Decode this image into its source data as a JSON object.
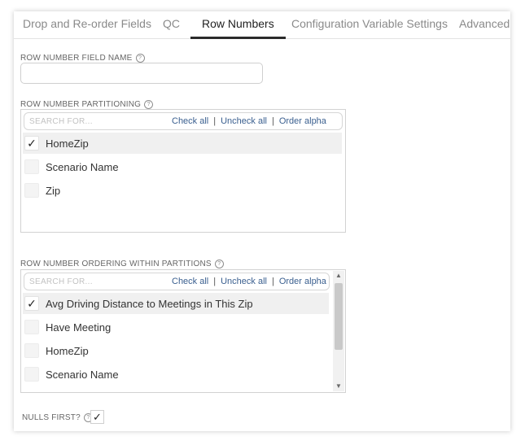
{
  "tabs": [
    {
      "label": "Drop and Re-order Fields",
      "active": false
    },
    {
      "label": "QC",
      "active": false
    },
    {
      "label": "Row Numbers",
      "active": true
    },
    {
      "label": "Configuration Variable Settings",
      "active": false
    },
    {
      "label": "Advanced",
      "active": false
    }
  ],
  "row_number_field": {
    "label": "ROW NUMBER FIELD NAME",
    "help": "?",
    "value": "",
    "placeholder": ""
  },
  "partitioning": {
    "label": "ROW NUMBER PARTITIONING",
    "help": "?",
    "search_placeholder": "SEARCH FOR...",
    "check_all": "Check all",
    "uncheck_all": "Uncheck all",
    "order_alpha": "Order alpha",
    "separator": "|",
    "items": [
      {
        "label": "HomeZip",
        "checked": true,
        "check": "✓"
      },
      {
        "label": "Scenario Name",
        "checked": false,
        "check": ""
      },
      {
        "label": "Zip",
        "checked": false,
        "check": ""
      }
    ]
  },
  "ordering": {
    "label": "ROW NUMBER ORDERING WITHIN PARTITIONS",
    "help": "?",
    "search_placeholder": "SEARCH FOR...",
    "check_all": "Check all",
    "uncheck_all": "Uncheck all",
    "order_alpha": "Order alpha",
    "separator": "|",
    "items": [
      {
        "label": "Avg Driving Distance to Meetings in This Zip",
        "checked": true,
        "check": "✓"
      },
      {
        "label": "Have Meeting",
        "checked": false,
        "check": ""
      },
      {
        "label": "HomeZip",
        "checked": false,
        "check": ""
      },
      {
        "label": "Scenario Name",
        "checked": false,
        "check": ""
      }
    ],
    "scroll_up_icon": "▲",
    "scroll_down_icon": "▼"
  },
  "nulls_first": {
    "label": "NULLS FIRST?",
    "help": "?",
    "checked": true,
    "check": "✓"
  }
}
